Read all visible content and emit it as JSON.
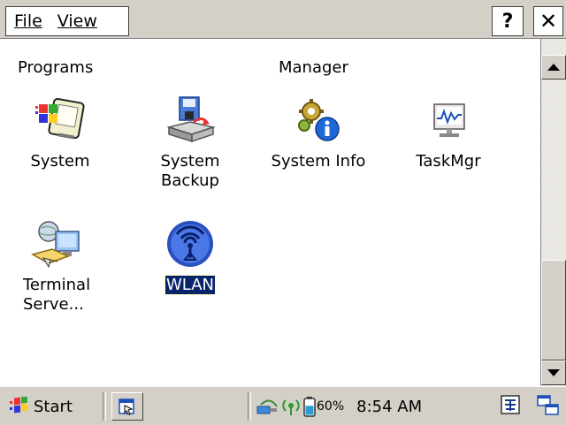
{
  "menubar": {
    "file_label": "File",
    "view_label": "View",
    "help_label": "?",
    "close_label": "✕"
  },
  "groups": [
    {
      "header": "Programs"
    },
    {
      "header": "Manager"
    }
  ],
  "icons": [
    {
      "label": "System",
      "icon": "system-icon"
    },
    {
      "label": "System Backup",
      "icon": "system-backup-icon"
    },
    {
      "label": "System Info",
      "icon": "system-info-icon"
    },
    {
      "label": "TaskMgr",
      "icon": "task-manager-icon"
    },
    {
      "label": "Terminal Serve...",
      "icon": "terminal-server-icon"
    },
    {
      "label": "WLAN",
      "icon": "wlan-icon",
      "selected": true
    }
  ],
  "taskbar": {
    "start_label": "Start",
    "battery_percent": "60%",
    "battery_level": 0.6,
    "clock": "8:54 AM"
  }
}
